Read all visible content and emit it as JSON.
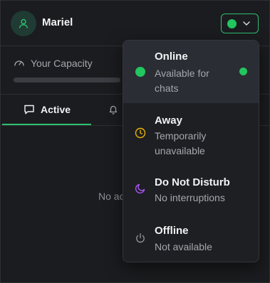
{
  "user": {
    "name": "Mariel"
  },
  "capacity": {
    "label": "Your Capacity",
    "fill_fraction": 0
  },
  "tabs": {
    "active_label": "Active"
  },
  "main": {
    "empty_text": "No ac"
  },
  "status_menu": {
    "selected": "online",
    "options": [
      {
        "key": "online",
        "title": "Online",
        "desc": "Available for chats",
        "color": "#22c55e",
        "icon": "online-dot-icon"
      },
      {
        "key": "away",
        "title": "Away",
        "desc": "Temporarily unavailable",
        "color": "#eab308",
        "icon": "clock-icon"
      },
      {
        "key": "dnd",
        "title": "Do Not Disturb",
        "desc": "No interruptions",
        "color": "#a855f7",
        "icon": "moon-icon"
      },
      {
        "key": "offline",
        "title": "Offline",
        "desc": "Not available",
        "color": "#8a8f95",
        "icon": "power-icon"
      }
    ]
  },
  "colors": {
    "accent": "#2fbf71",
    "online": "#22c55e",
    "background": "#1b1c1f"
  }
}
